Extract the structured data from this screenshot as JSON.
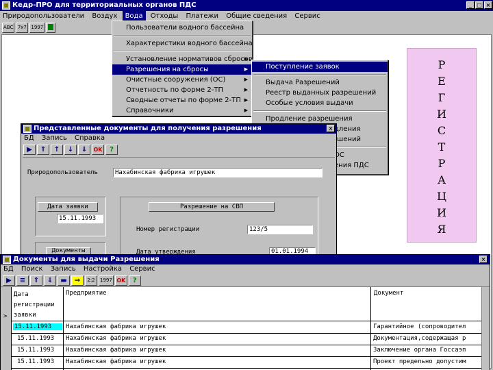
{
  "main_window": {
    "title": "Кедр-ПРО для территориальных органов ПДС",
    "menu": [
      "Природопользователи",
      "Воздух",
      "Вода",
      "Отходы",
      "Платежи",
      "Общие сведения",
      "Сервис"
    ],
    "toolbar": [
      "ABC",
      "7x7",
      "1997",
      ""
    ]
  },
  "voda_menu": {
    "items": [
      {
        "label": "Пользователи водного бассейна",
        "arrow": ""
      },
      {
        "label": "Характеристики водного бассейна",
        "arrow": ""
      },
      {
        "label": "Установление нормативов сбросов",
        "arrow": "▶"
      },
      {
        "label": "Разрешения на сбросы",
        "arrow": "▶"
      },
      {
        "label": "Очистные сооружения (ОС)",
        "arrow": "▶"
      },
      {
        "label": "Отчетность по форме 2-ТП",
        "arrow": "▶"
      },
      {
        "label": "Сводные отчеты по форме 2-ТП",
        "arrow": "▶"
      },
      {
        "label": "Справочники",
        "arrow": "▶"
      }
    ]
  },
  "sub_menu": {
    "items": [
      "Поступление заявок",
      "Выдача Разрешений",
      "Реестр выданных разрешений",
      "Особые условия выдачи",
      "Продление разрешения",
      "Аннулирование",
      "Реестр разрешений",
      "Контроль ОС",
      "Выдача Разрешения ПДС"
    ],
    "visible_tails": [
      "",
      "",
      "",
      "",
      "",
      "дления",
      "ешений",
      "ОС",
      "ения ПДС"
    ]
  },
  "registration_banner": {
    "letters": [
      "Р",
      "Е",
      "Г",
      "И",
      "С",
      "Т",
      "Р",
      "А",
      "Ц",
      "И",
      "Я"
    ]
  },
  "docs_window": {
    "title": "Представленные документы для получения разрешения",
    "menu": [
      "БД",
      "Запись",
      "Справка"
    ],
    "toolbar": [
      "▶",
      "⇑",
      "↑",
      "↓",
      "⇓",
      "OK",
      "?"
    ],
    "nature_user_label": "Природопользователь",
    "nature_user_value": "Нахабинская фабрика игрушек",
    "application_date_label": "Дата заявки",
    "application_date_value": "15.11.1993",
    "permit_header": "Разрешение на СВП",
    "reg_number_label": "Номер регистрации",
    "reg_number_value": "123/5",
    "approval_date_label": "Дата утверждения",
    "approval_date_value": "01.01.1994",
    "documents_header": "Документы"
  },
  "issue_window": {
    "title": "Документы для выдачи Разрешения",
    "menu": [
      "БД",
      "Поиск",
      "Запись",
      "Настройка",
      "Сервис"
    ],
    "toolbar": [
      "▶",
      "≡",
      "⇑",
      "⇓",
      "▬",
      "⇒",
      "2:2",
      "1997",
      "OK",
      "?"
    ],
    "columns": [
      {
        "label": "Дата регистрации заявки"
      },
      {
        "label": "Предприятие"
      },
      {
        "label": "Документ"
      }
    ],
    "rows": [
      {
        "date": "15.11.1993",
        "company": "Нахабинская фабрика игрушек",
        "doc": "Гарантийное (сопроводител"
      },
      {
        "date": "15.11.1993",
        "company": "Нахабинская фабрика игрушек",
        "doc": "Документация,содержащая р"
      },
      {
        "date": "15.11.1993",
        "company": "Нахабинская фабрика игрушек",
        "doc": "Заключение органа Госсаэп"
      },
      {
        "date": "15.11.1993",
        "company": "Нахабинская фабрика игрушек",
        "doc": "Проект предельно допустим"
      }
    ],
    "row_marker": ">"
  }
}
